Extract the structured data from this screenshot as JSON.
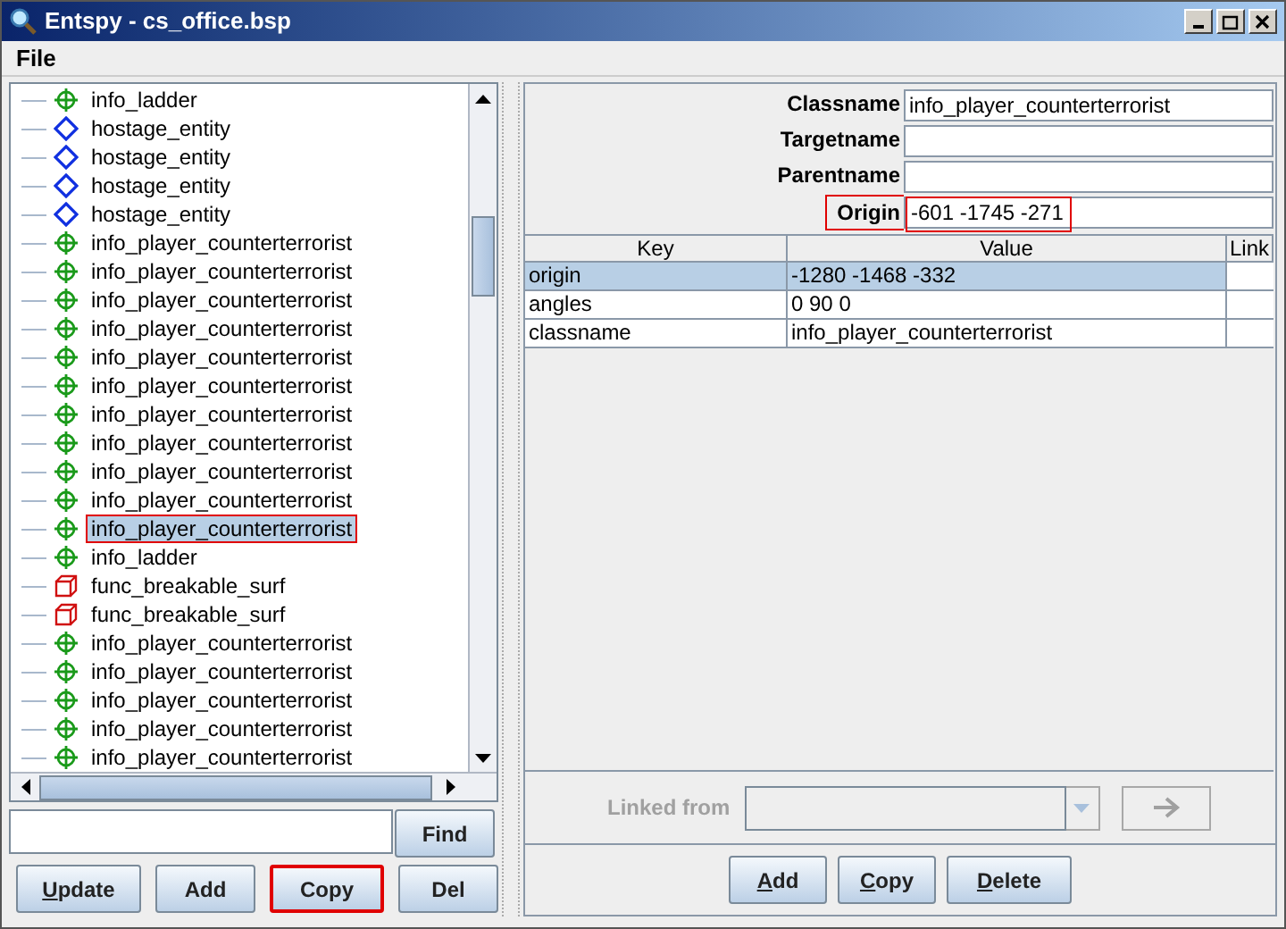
{
  "window": {
    "title": "Entspy - cs_office.bsp"
  },
  "menu": [
    "File"
  ],
  "tree": [
    {
      "label": "info_ladder",
      "kind": "crosshair",
      "selected": false
    },
    {
      "label": "hostage_entity",
      "kind": "diamond",
      "selected": false
    },
    {
      "label": "hostage_entity",
      "kind": "diamond",
      "selected": false
    },
    {
      "label": "hostage_entity",
      "kind": "diamond",
      "selected": false
    },
    {
      "label": "hostage_entity",
      "kind": "diamond",
      "selected": false
    },
    {
      "label": "info_player_counterterrorist",
      "kind": "crosshair",
      "selected": false
    },
    {
      "label": "info_player_counterterrorist",
      "kind": "crosshair",
      "selected": false
    },
    {
      "label": "info_player_counterterrorist",
      "kind": "crosshair",
      "selected": false
    },
    {
      "label": "info_player_counterterrorist",
      "kind": "crosshair",
      "selected": false
    },
    {
      "label": "info_player_counterterrorist",
      "kind": "crosshair",
      "selected": false
    },
    {
      "label": "info_player_counterterrorist",
      "kind": "crosshair",
      "selected": false
    },
    {
      "label": "info_player_counterterrorist",
      "kind": "crosshair",
      "selected": false
    },
    {
      "label": "info_player_counterterrorist",
      "kind": "crosshair",
      "selected": false
    },
    {
      "label": "info_player_counterterrorist",
      "kind": "crosshair",
      "selected": false
    },
    {
      "label": "info_player_counterterrorist",
      "kind": "crosshair",
      "selected": false
    },
    {
      "label": "info_player_counterterrorist",
      "kind": "crosshair",
      "selected": true
    },
    {
      "label": "info_ladder",
      "kind": "crosshair",
      "selected": false
    },
    {
      "label": "func_breakable_surf",
      "kind": "box",
      "selected": false
    },
    {
      "label": "func_breakable_surf",
      "kind": "box",
      "selected": false
    },
    {
      "label": "info_player_counterterrorist",
      "kind": "crosshair",
      "selected": false
    },
    {
      "label": "info_player_counterterrorist",
      "kind": "crosshair",
      "selected": false
    },
    {
      "label": "info_player_counterterrorist",
      "kind": "crosshair",
      "selected": false
    },
    {
      "label": "info_player_counterterrorist",
      "kind": "crosshair",
      "selected": false
    },
    {
      "label": "info_player_counterterrorist",
      "kind": "crosshair",
      "selected": false
    }
  ],
  "find_button": "Find",
  "left_buttons": [
    {
      "label": "Update",
      "underlined": true,
      "highlighted": false
    },
    {
      "label": "Add",
      "underlined": false,
      "highlighted": false
    },
    {
      "label": "Copy",
      "underlined": false,
      "highlighted": true
    },
    {
      "label": "Del",
      "underlined": false,
      "highlighted": false
    }
  ],
  "fields": [
    {
      "label": "Classname",
      "value": "info_player_counterterrorist",
      "highlighted": false
    },
    {
      "label": "Targetname",
      "highlighted": false
    },
    {
      "label": "Parentname",
      "highlighted": false
    },
    {
      "label": "Origin",
      "value": "-601 -1745 -271",
      "highlighted": true
    }
  ],
  "table": {
    "columns": [
      "Key",
      "Value",
      "Link"
    ],
    "rows": [
      {
        "key": "origin",
        "value": "-1280 -1468 -332",
        "selected": true
      },
      {
        "key": "angles",
        "value": "0 90 0",
        "selected": false
      },
      {
        "key": "classname",
        "value": "info_player_counterterrorist",
        "selected": false
      }
    ]
  },
  "linked_from": {
    "label": "Linked from",
    "disabled": true
  },
  "right_buttons": [
    {
      "label": "Add",
      "underlined": true
    },
    {
      "label": "Copy",
      "underlined": true
    },
    {
      "label": "Delete",
      "underlined": true
    }
  ]
}
